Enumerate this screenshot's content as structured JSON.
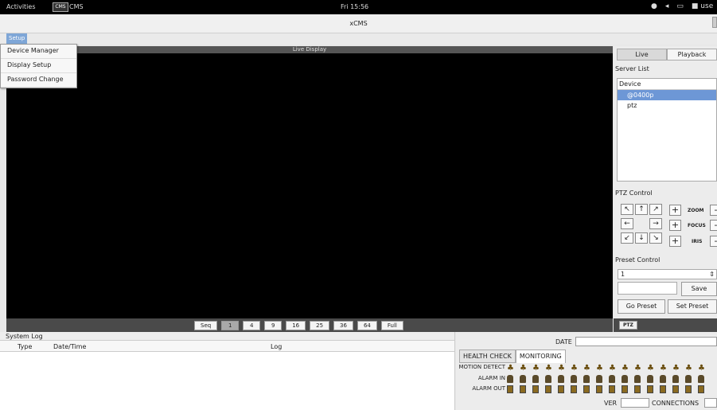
{
  "topbar": {
    "activities": "Activities",
    "app_icon": "CMS",
    "app_name": "CMS",
    "clock": "Fri 15:56",
    "user": "use"
  },
  "window": {
    "title": "xCMS"
  },
  "menu": {
    "setup": "Setup",
    "items": [
      "Device Manager",
      "Display Setup",
      "Password Change"
    ]
  },
  "live": {
    "header": "Live Display"
  },
  "view_buttons": [
    "Seq",
    "1",
    "4",
    "9",
    "16",
    "25",
    "36",
    "64",
    "Full"
  ],
  "right": {
    "tabs": [
      "Live",
      "Playback"
    ],
    "server_list": "Server List",
    "device_header": "Device",
    "devices": [
      "@0400p",
      "ptz"
    ],
    "ptz_control": "PTZ Control",
    "arrows": [
      "↖",
      "↑",
      "↗",
      "←",
      "→",
      "↙",
      "↓",
      "↘"
    ],
    "zoom": "ZOOM",
    "focus": "FOCUS",
    "iris": "IRIS",
    "preset_control": "Preset Control",
    "preset_value": "1",
    "save": "Save",
    "go_preset": "Go Preset",
    "set_preset": "Set Preset",
    "ptz_button": "PTZ"
  },
  "syslog": {
    "title": "System Log",
    "cols": [
      "Type",
      "Date/Time",
      "Log"
    ]
  },
  "status": {
    "date_label": "DATE",
    "tabs": [
      "HEALTH CHECK",
      "MONITORING"
    ],
    "motion_detect": "MOTION DETECT",
    "alarm_in": "ALARM IN",
    "alarm_out": "ALARM OUT",
    "ver": "VER",
    "connections": "CONNECTIONS"
  },
  "colors": {
    "accent": "#6d97d6",
    "video_bg": "#000000"
  }
}
